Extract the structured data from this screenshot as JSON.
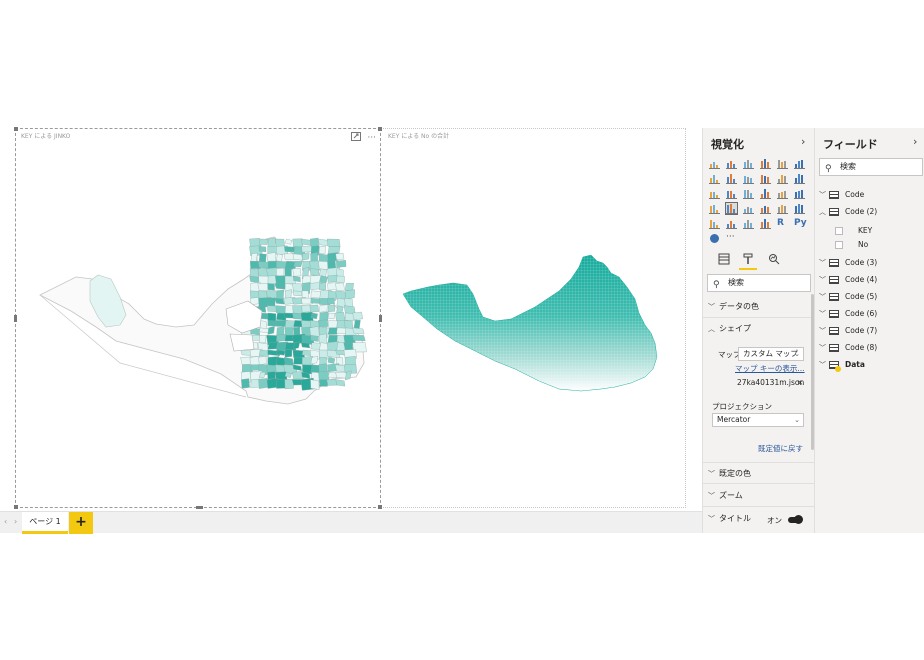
{
  "canvas": {
    "left_visual_title": "KEY による JINKO",
    "right_visual_title": "KEY による No の合計",
    "focus_icon": "focus-mode-icon",
    "more_icon": "more-options-icon",
    "more_glyph": "···"
  },
  "page_tabs": {
    "nav_prev": "‹",
    "nav_next": "›",
    "current": "ページ 1",
    "add": "+"
  },
  "visualizations": {
    "title": "視覚化",
    "collapse_glyph": "›",
    "more_glyph": "···",
    "tabs": [
      "fields-tab-icon",
      "format-paintbrush-icon",
      "analytics-icon"
    ],
    "search_placeholder": "検索",
    "sections": {
      "data_colors": "データの色",
      "shape": "シェイプ",
      "default_colors": "既定の色",
      "zoom": "ズーム",
      "title": "タイトル"
    },
    "shape": {
      "map_label": "マップ",
      "map_value": "カスタム マップ",
      "map_keys_link": "マップ キーの表示...",
      "file_name": "27ka40131m.json",
      "file_remove": "×",
      "projection_label": "プロジェクション",
      "projection_value": "Mercator",
      "reset_link": "既定値に戻す"
    },
    "title_toggle_label": "オン",
    "title_toggle_on": true
  },
  "fields": {
    "title": "フィールド",
    "collapse_glyph": "›",
    "search_placeholder": "検索",
    "tables": [
      {
        "name": "Code",
        "expanded": false
      },
      {
        "name": "Code (2)",
        "expanded": true,
        "columns": [
          "KEY",
          "No"
        ]
      },
      {
        "name": "Code (3)",
        "expanded": false
      },
      {
        "name": "Code (4)",
        "expanded": false
      },
      {
        "name": "Code (5)",
        "expanded": false
      },
      {
        "name": "Code (6)",
        "expanded": false
      },
      {
        "name": "Code (7)",
        "expanded": false
      },
      {
        "name": "Code (8)",
        "expanded": false
      },
      {
        "name": "Data",
        "expanded": false,
        "highlighted": true
      }
    ]
  },
  "colors": {
    "accent_yellow": "#f2c811",
    "map_teal": "#1fb4a6",
    "map_light": "#e3f5f3",
    "link_blue": "#2b579a"
  }
}
